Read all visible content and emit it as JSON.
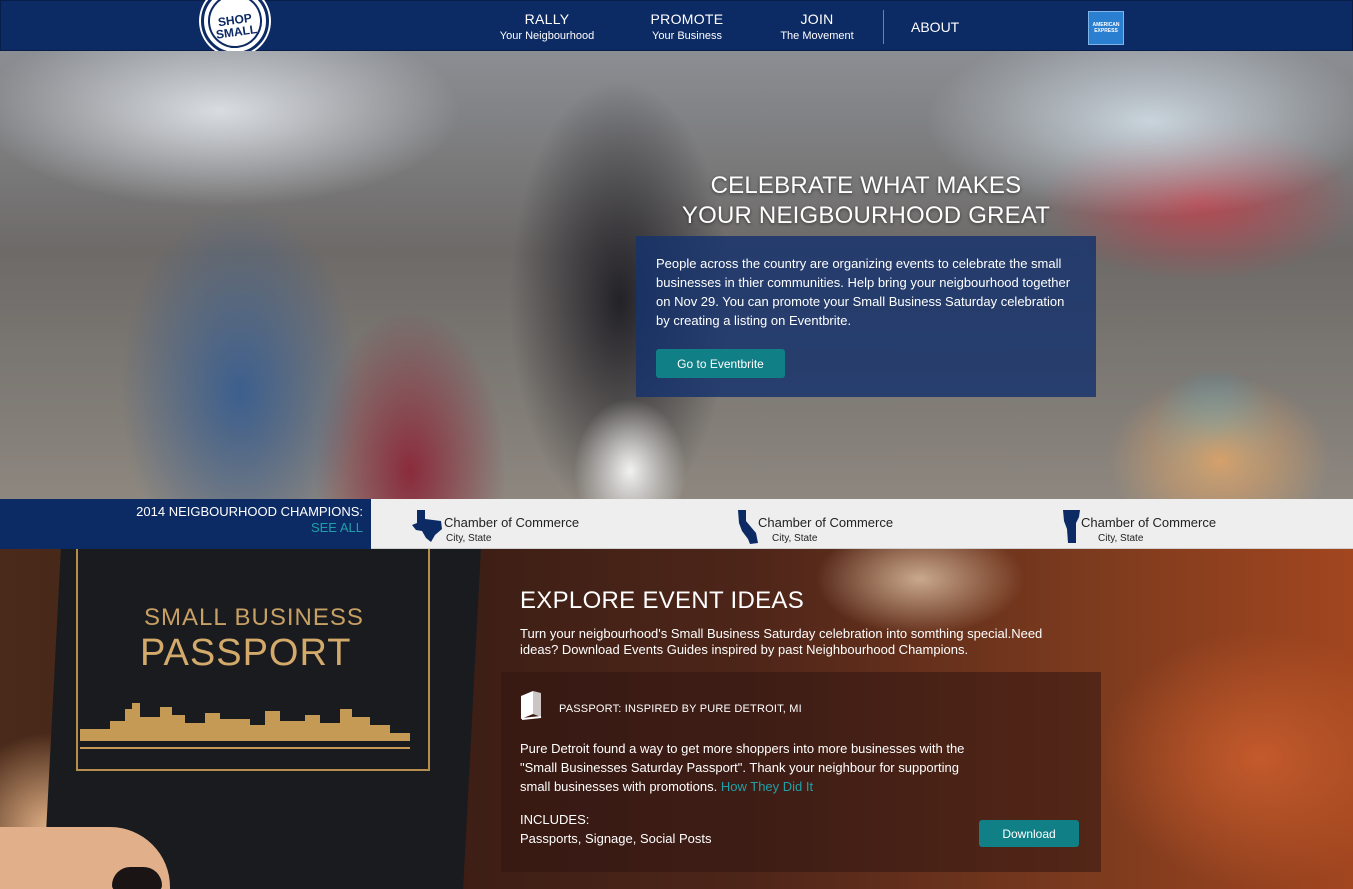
{
  "nav": {
    "logo_line1": "SHOP",
    "logo_line2": "SMALL",
    "items": [
      {
        "main": "RALLY",
        "sub": "Your Neigbourhood"
      },
      {
        "main": "PROMOTE",
        "sub": "Your Business"
      },
      {
        "main": "JOIN",
        "sub": "The Movement"
      }
    ],
    "about": "ABOUT",
    "amex_line1": "AMERICAN",
    "amex_line2": "EXPRESS"
  },
  "hero": {
    "title_line1": "CELEBRATE WHAT MAKES",
    "title_line2": "YOUR NEIGBOURHOOD GREAT",
    "body": "People across the country are organizing events to celebrate the small businesses in thier communities. Help bring your neigbourhood together on Nov 29. You can promote your Small Business Saturday celebration by creating a listing on Eventbrite.",
    "cta": "Go to Eventbrite"
  },
  "champions": {
    "heading": "2014 NEIGBOURHOOD CHAMPIONS:",
    "see_all": "SEE ALL",
    "items": [
      {
        "name": "Chamber of Commerce",
        "location": "City, State",
        "icon": "texas-state-icon"
      },
      {
        "name": "Chamber of Commerce",
        "location": "City, State",
        "icon": "california-state-icon"
      },
      {
        "name": "Chamber of Commerce",
        "location": "City, State",
        "icon": "vermont-state-icon"
      }
    ]
  },
  "explore": {
    "passport_line1": "SMALL BUSINESS",
    "passport_line2": "PASSPORT",
    "title": "EXPLORE EVENT IDEAS",
    "description": "Turn your neigbourhood's Small Business Saturday celebration into somthing special.Need ideas? Download Events Guides inspired by past Neighbourhood Champions.",
    "card": {
      "heading": "PASSPORT: INSPIRED BY PURE DETROIT, MI",
      "body": "Pure Detroit found a way to get more shoppers into more businesses with the \"Small Businesses Saturday Passport\". Thank your neighbour for supporting small businesses with promotions.",
      "link": "How They Did It",
      "includes_label": "INCLUDES:",
      "includes_items": "Passports, Signage, Social Posts",
      "download": "Download"
    }
  },
  "colors": {
    "navy": "#0c2a63",
    "teal": "#117f86",
    "link_teal": "#1fa0a8"
  }
}
